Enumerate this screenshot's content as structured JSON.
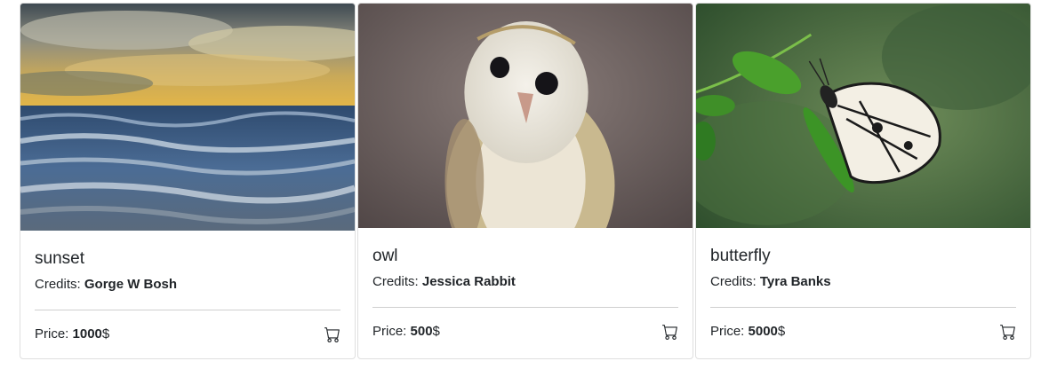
{
  "cards": [
    {
      "title": "sunset",
      "credits_label": "Credits:",
      "credits_name": "Gorge W Bosh",
      "price_label": "Price:",
      "price_value": "1000",
      "currency": "$",
      "icon": "cart-icon"
    },
    {
      "title": "owl",
      "credits_label": "Credits:",
      "credits_name": "Jessica Rabbit",
      "price_label": "Price:",
      "price_value": "500",
      "currency": "$",
      "icon": "cart-icon"
    },
    {
      "title": "butterfly",
      "credits_label": "Credits:",
      "credits_name": "Tyra Banks",
      "price_label": "Price:",
      "price_value": "5000",
      "currency": "$",
      "icon": "cart-icon"
    }
  ]
}
